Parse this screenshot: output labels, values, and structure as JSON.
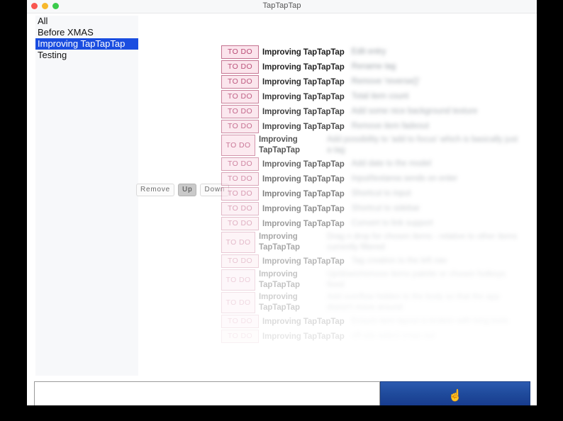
{
  "window": {
    "title": "TapTapTap",
    "traffic_lights": [
      "close-button",
      "minimize-button",
      "maximize-button"
    ]
  },
  "sidebar": {
    "items": [
      {
        "label": "All",
        "selected": false
      },
      {
        "label": "Before XMAS",
        "selected": false
      },
      {
        "label": "Improving TapTapTap",
        "selected": true
      },
      {
        "label": "Testing",
        "selected": false
      }
    ],
    "selected_color": "#1a4de0"
  },
  "list_controls": {
    "buttons": [
      {
        "label": "Remove",
        "active": false
      },
      {
        "label": "Up",
        "active": true
      },
      {
        "label": "Down",
        "active": false
      }
    ]
  },
  "task_list": {
    "badge_label": "TO DO",
    "badge_color": "#b84a74",
    "badge_background": "#fbe4ec",
    "badge_border": "#c3718f",
    "tag_label": "Improving TapTapTap",
    "rows": [
      {
        "status": "TO DO",
        "tag": "Improving TapTapTap",
        "description": "Edit entry",
        "wrap": false,
        "opacity": 1.0
      },
      {
        "status": "TO DO",
        "tag": "Improving TapTapTap",
        "description": "Rename tag",
        "wrap": false,
        "opacity": 0.96
      },
      {
        "status": "TO DO",
        "tag": "Improving TapTapTap",
        "description": "Remove 'reverse()'",
        "wrap": false,
        "opacity": 0.92
      },
      {
        "status": "TO DO",
        "tag": "Improving TapTapTap",
        "description": "Total item count",
        "wrap": false,
        "opacity": 0.88
      },
      {
        "status": "TO DO",
        "tag": "Improving TapTapTap",
        "description": "Add some nice background texture",
        "wrap": false,
        "opacity": 0.84
      },
      {
        "status": "TO DO",
        "tag": "Improving TapTapTap",
        "description": "Remove item fadeout",
        "wrap": false,
        "opacity": 0.8
      },
      {
        "status": "TO DO",
        "tag": "Improving TapTapTap",
        "description": "Add possibility to 'add to focus' which is basically just a tag",
        "wrap": true,
        "opacity": 0.74
      },
      {
        "status": "TO DO",
        "tag": "Improving TapTapTap",
        "description": "Add date to the model",
        "wrap": false,
        "opacity": 0.68
      },
      {
        "status": "TO DO",
        "tag": "Improving TapTapTap",
        "description": "Input/textarea sends on enter",
        "wrap": false,
        "opacity": 0.62
      },
      {
        "status": "TO DO",
        "tag": "Improving TapTapTap",
        "description": "Shortcut to input",
        "wrap": false,
        "opacity": 0.56
      },
      {
        "status": "TO DO",
        "tag": "Improving TapTapTap",
        "description": "Shortcut to sidebar",
        "wrap": false,
        "opacity": 0.5
      },
      {
        "status": "TO DO",
        "tag": "Improving TapTapTap",
        "description": "Convert to link support",
        "wrap": false,
        "opacity": 0.44
      },
      {
        "status": "TO DO",
        "tag": "Improving TapTapTap",
        "description": "Drag n drop for chosen items - relative to other items currently filtered",
        "wrap": true,
        "opacity": 0.38
      },
      {
        "status": "TO DO",
        "tag": "Improving TapTapTap",
        "description": "Tag creation to the left nav",
        "wrap": false,
        "opacity": 0.32
      },
      {
        "status": "TO DO",
        "tag": "Improving TapTapTap",
        "description": "Up/down/remove items palette or chosen hotkeys fixed",
        "wrap": true,
        "opacity": 0.26
      },
      {
        "status": "TO DO",
        "tag": "Improving TapTapTap",
        "description": "Add overflow hidden to the body so that the app doesn't move around",
        "wrap": true,
        "opacity": 0.2
      },
      {
        "status": "TO DO",
        "tag": "Improving TapTapTap",
        "description": "Ensure item layout is broken with long texts",
        "wrap": false,
        "opacity": 0.15
      },
      {
        "status": "TO DO",
        "tag": "Improving TapTapTap",
        "description": "off-site select cross out",
        "wrap": false,
        "opacity": 0.1
      }
    ]
  },
  "bottom_bar": {
    "input_value": "",
    "input_placeholder": "",
    "submit_icon": "☝",
    "submit_icon_name": "pointing-up-hand-icon",
    "submit_color": "#1f4a9b"
  }
}
